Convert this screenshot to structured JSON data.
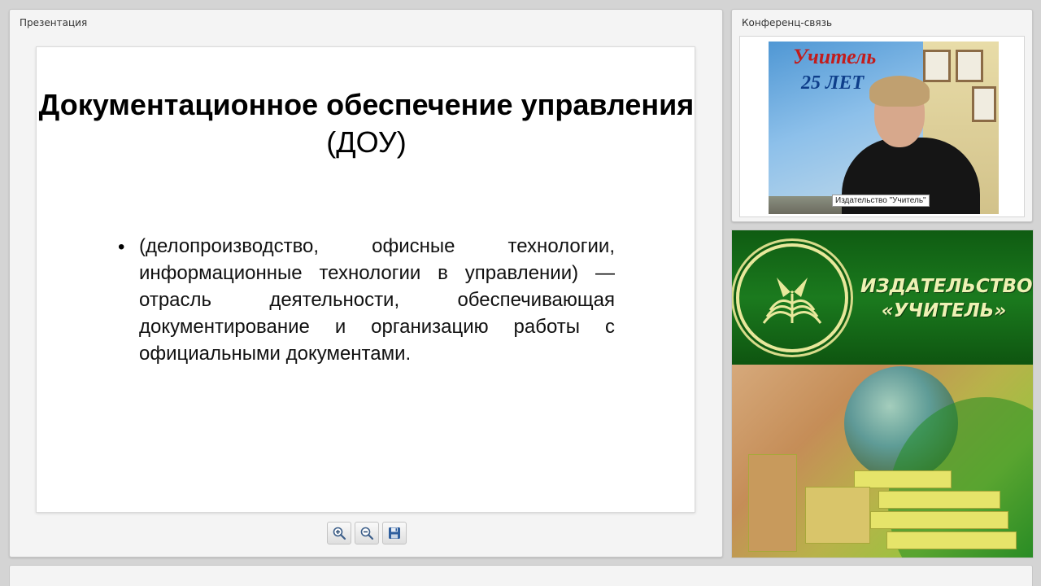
{
  "presentation": {
    "title": "Презентация",
    "slide": {
      "title_bold": "Документационное обеспечение управления",
      "title_regular": " (ДОУ)",
      "bullet": "•",
      "body": "(делопроизводство, офисные технологии, информационные технологии в управлении) — отрасль деятельности, обеспечивающая документирование и организацию работы с официальными документами."
    },
    "toolbar": {
      "zoom_in_icon": "zoom-in-icon",
      "zoom_out_icon": "zoom-out-icon",
      "save_icon": "save-icon"
    }
  },
  "conference": {
    "title": "Конференц-связь",
    "video_caption": "Издательство \"Учитель\"",
    "banner": {
      "brand": "Учитель",
      "years": "25 ЛЕТ"
    }
  },
  "brand": {
    "line1": "ИЗДАТЕЛЬСТВО",
    "line2": "«УЧИТЕЛЬ»"
  },
  "colors": {
    "brand_green": "#1b7a1e",
    "brand_text": "#eef1b4",
    "panel_bg": "#f4f4f4"
  }
}
